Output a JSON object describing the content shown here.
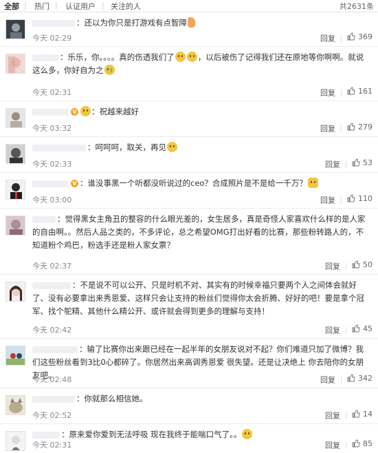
{
  "tabs": [
    {
      "label": "全部",
      "active": true
    },
    {
      "label": "热门",
      "active": false
    },
    {
      "label": "认证用户",
      "active": false
    },
    {
      "label": "关注的人",
      "active": false
    }
  ],
  "total_count": "共2631条",
  "reply_label": "回复",
  "comments": [
    {
      "text": "：还以为你只是打游戏有点智障",
      "time": "今天 02:29",
      "likes": "369"
    },
    {
      "text": "：乐乐，你。。。。真的伤透我们了",
      "text2": "，以后被伤了记得我们还在原地等你啊啊。就说这么多，你好自为之",
      "time": "今天 02:31",
      "likes": "161"
    },
    {
      "text": "：祝越来越好",
      "time": "今天 03:32",
      "likes": "279"
    },
    {
      "text": "：呵呵呵，取关，再见",
      "time": "今天 02:33",
      "likes": "53"
    },
    {
      "text": "：谁没事黑一个听都没听说过的ceo？合成照片是不是给一千万？",
      "time": "今天 03:00",
      "likes": "110"
    },
    {
      "text": "：觉得黑女主角丑的整容的什么眼光差的，女生居多，真是奇怪人家喜欢什么样的是人家的自由啊。。然后人品之类的，不多评论，总之希望OMG打出好看的比赛，那些粉转路人的，不知道粉个鸡巴，粉选手还是粉人家女票？",
      "time": "今天 02:37",
      "likes": "50"
    },
    {
      "text": "：不是说不可以公开、只是时机不对、其实有的时候幸福只要两个人之间体会就好了、没有必要拿出来秀恩爱、这样只会让支持的粉丝们觉得你太会折腾、好好的吧！要是拿个冠军、找个鸵精、其他什么精公开、或许就会得到更多的理解与支持！",
      "time": "今天 02:42",
      "likes": "45"
    },
    {
      "text": "：输了比赛你出来跟已经在一起半年的女朋友说对不起？你们难道只加了微博？我们这些粉丝看到3比0心都碎了。你居然出来高调秀恩爱 很失望。还是让决绝上 你去陪你的女朋友吧。",
      "time": "今天 02:48",
      "likes": "342"
    },
    {
      "text": "：你就那么相信她。",
      "time": "今天 02:52",
      "likes": "14"
    },
    {
      "text": "：原来爱你爱到无法呼吸 现在我终于能喘口气了。。",
      "time": "今天 02:31",
      "likes": "85"
    }
  ]
}
